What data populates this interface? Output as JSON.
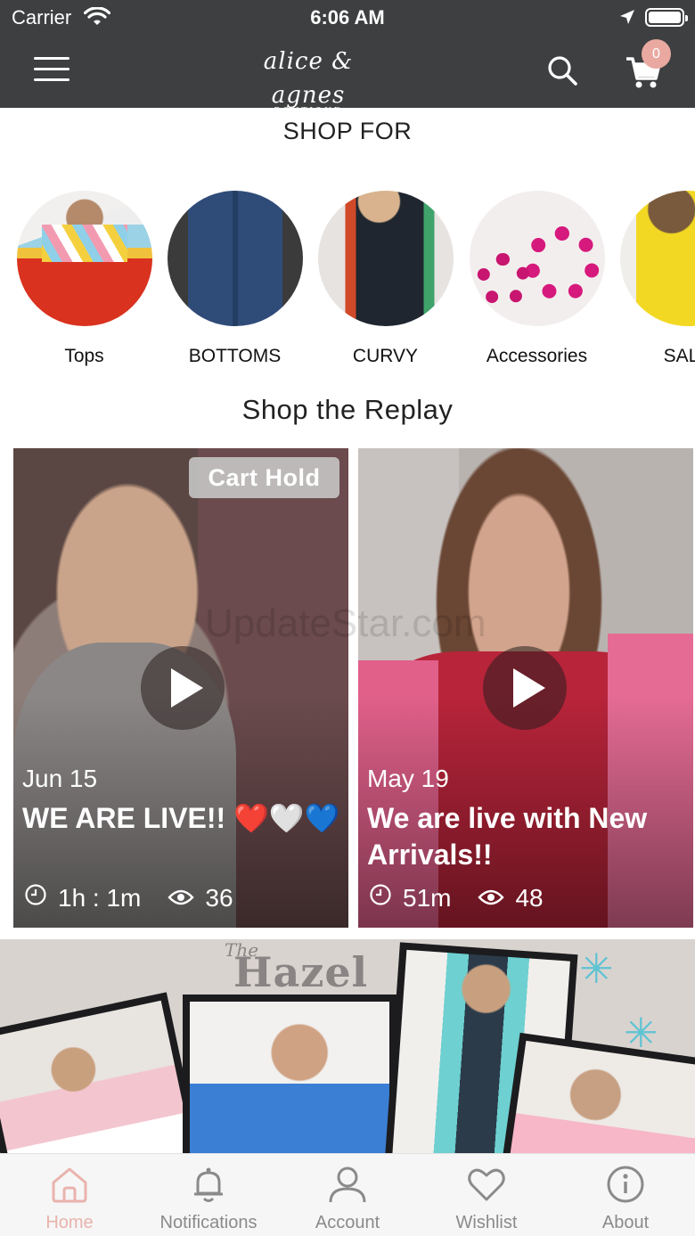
{
  "status_bar": {
    "carrier": "Carrier",
    "time": "6:06 AM"
  },
  "header": {
    "logo_script": "alice & agnes",
    "logo_sub": "BOUTIQUE",
    "cart_count": "0"
  },
  "shop_for": {
    "title": "SHOP FOR",
    "categories": [
      {
        "label": "Tops"
      },
      {
        "label": "BOTTOMS"
      },
      {
        "label": "CURVY"
      },
      {
        "label": "Accessories"
      },
      {
        "label": "SALE"
      }
    ]
  },
  "replay": {
    "title": "Shop the Replay",
    "videos": [
      {
        "badge": "Cart Hold",
        "date": "Jun 15",
        "title": "WE ARE LIVE!! ❤️🤍💙",
        "duration": "1h : 1m",
        "views": "36"
      },
      {
        "badge": "",
        "date": "May 19",
        "title": "We are live with New Arrivals!!",
        "duration": "51m",
        "views": "48"
      }
    ]
  },
  "watermark": "UpdateStar.com",
  "banner": {
    "the": "The",
    "name": "Hazel"
  },
  "tabbar": {
    "tabs": [
      {
        "label": "Home"
      },
      {
        "label": "Notifications"
      },
      {
        "label": "Account"
      },
      {
        "label": "Wishlist"
      },
      {
        "label": "About"
      }
    ]
  },
  "colors": {
    "header_bg": "#3d3f40",
    "accent": "#e9b3ad",
    "tab_inactive": "#8a8a8a"
  }
}
